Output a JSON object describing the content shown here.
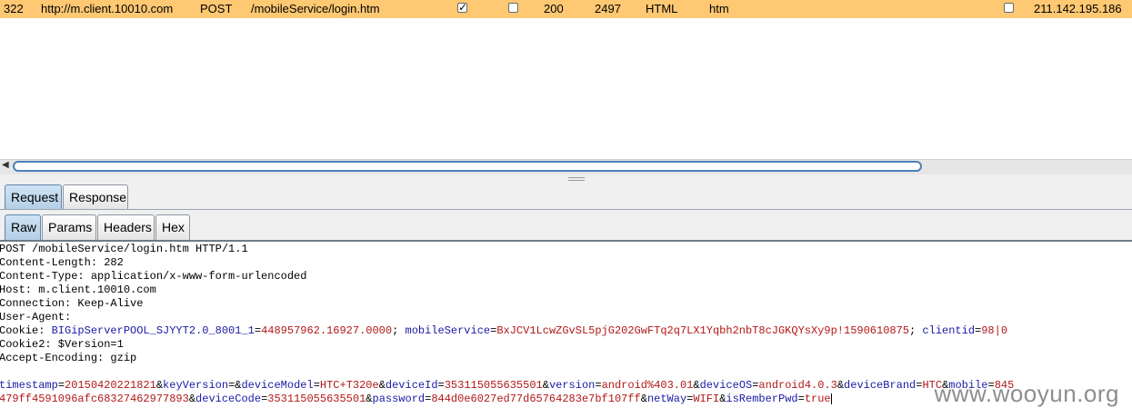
{
  "history_row": {
    "number": "322",
    "host": "http://m.client.10010.com",
    "method": "POST",
    "url": "/mobileService/login.htm",
    "params_checked": true,
    "edited_checked": false,
    "status": "200",
    "length": "2497",
    "mime": "HTML",
    "extension": "htm",
    "ssl_checked": false,
    "ip": "211.142.195.186"
  },
  "tabs_top": [
    "Request",
    "Response"
  ],
  "tabs_sub": [
    "Raw",
    "Params",
    "Headers",
    "Hex"
  ],
  "raw": {
    "line1": "POST /mobileService/login.htm HTTP/1.1",
    "line2": "Content-Length: 282",
    "line3": "Content-Type: application/x-www-form-urlencoded",
    "line4": "Host: m.client.10010.com",
    "line5": "Connection: Keep-Alive",
    "line6": "User-Agent:",
    "cookie": {
      "label": "Cookie: ",
      "k1": "BIGipServerPOOL_SJYYT2.0_8001_1",
      "v1": "448957962.16927.0000",
      "k2": "mobileService",
      "v2": "BxJCV1LcwZGvSL5pjG202GwFTq2q7LX1Yqbh2nbT8cJGKQYsXy9p!1590610875",
      "k3": "clientid",
      "v3": "98|0"
    },
    "line8": "Cookie2: $Version=1",
    "line9": "Accept-Encoding: gzip",
    "body1": {
      "k1": "timestamp",
      "v1": "20150420221821",
      "k2": "keyVersion",
      "v2": "",
      "k3": "deviceModel",
      "v3": "HTC+T320e",
      "k4": "deviceId",
      "v4": "353115055635501",
      "k5": "version",
      "v5": "android%403.01",
      "k6": "deviceOS",
      "v6": "android4.0.3",
      "k7": "deviceBrand",
      "v7": "HTC",
      "k8": "mobile",
      "v8": "845"
    },
    "body2": {
      "v0": "479ff4591096afc68327462977893",
      "k1": "deviceCode",
      "v1": "353115055635501",
      "k2": "password",
      "v2": "844d0e6027ed77d65764283e7bf107ff",
      "k3": "netWay",
      "v3": "WIFI",
      "k4": "isRemberPwd",
      "v4": "true"
    }
  },
  "watermark": "www.wooyun.org",
  "colors": {
    "selected_row": "#ffc872",
    "param_key": "#1a1aa6",
    "param_value": "#b21818",
    "active_tab": "#b4cfe6"
  }
}
